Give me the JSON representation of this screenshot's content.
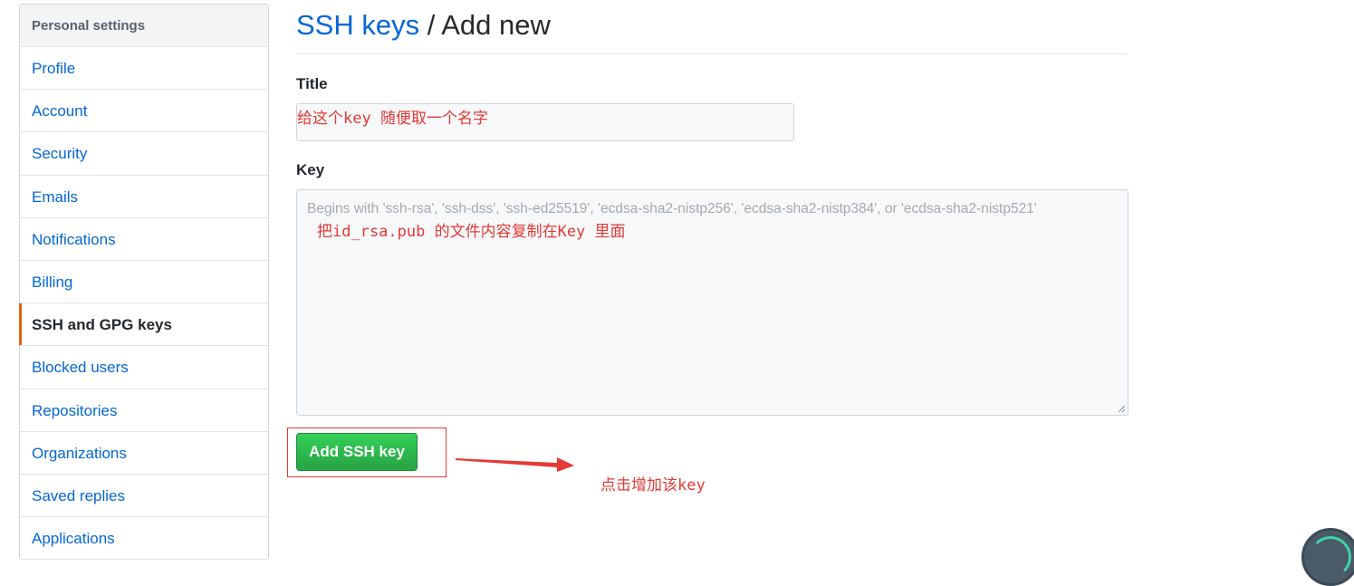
{
  "sidebar": {
    "header": "Personal settings",
    "items": [
      {
        "label": "Profile"
      },
      {
        "label": "Account"
      },
      {
        "label": "Security"
      },
      {
        "label": "Emails"
      },
      {
        "label": "Notifications"
      },
      {
        "label": "Billing"
      },
      {
        "label": "SSH and GPG keys",
        "selected": true
      },
      {
        "label": "Blocked users"
      },
      {
        "label": "Repositories"
      },
      {
        "label": "Organizations"
      },
      {
        "label": "Saved replies"
      },
      {
        "label": "Applications"
      }
    ]
  },
  "main": {
    "breadcrumb_link": "SSH keys",
    "breadcrumb_sep": " / ",
    "breadcrumb_current": "Add new",
    "title_label": "Title",
    "title_value": "",
    "key_label": "Key",
    "key_placeholder": "Begins with 'ssh-rsa', 'ssh-dss', 'ssh-ed25519', 'ecdsa-sha2-nistp256', 'ecdsa-sha2-nistp384', or 'ecdsa-sha2-nistp521'",
    "add_button_label": "Add SSH key"
  },
  "annotations": {
    "title_note": "给这个key 随便取一个名字",
    "key_note": "把id_rsa.pub 的文件内容复制在Key 里面",
    "button_note": "点击增加该key"
  },
  "colors": {
    "link": "#0366d6",
    "annotation": "#e53935",
    "button": "#28a745",
    "selected_marker": "#e36209"
  }
}
